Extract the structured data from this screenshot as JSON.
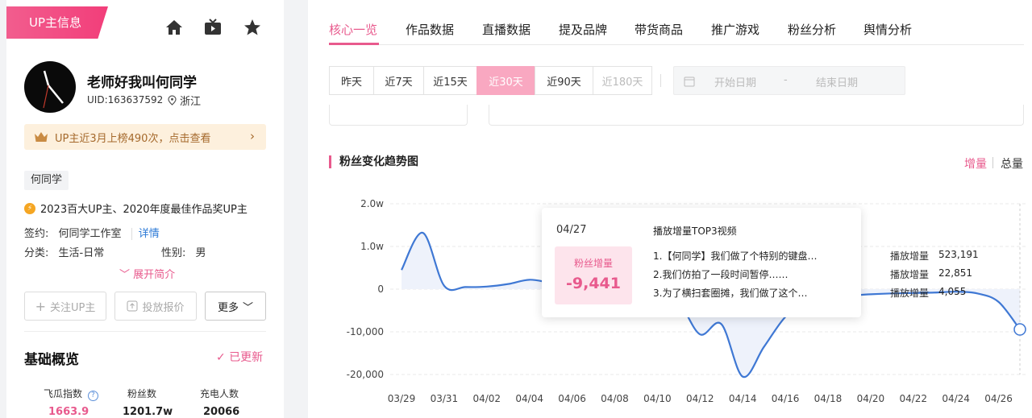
{
  "left": {
    "up_tag": "UP主信息",
    "icons": [
      "home-icon",
      "tv-icon",
      "star-icon"
    ],
    "name": "老师好我叫何同学",
    "uid": "UID:163637592",
    "location": "浙江",
    "rank_banner": "UP主近3月上榜490次，点击查看",
    "tag": "何同学",
    "award": "2023百大UP主、2020年度最佳作品奖UP主",
    "sign_label": "签约:",
    "sign_value": "何同学工作室",
    "detail_link": "详情",
    "category_label": "分类:",
    "category_value": "生活-日常",
    "gender_label": "性别:",
    "gender_value": "男",
    "expand": "展开简介",
    "buttons": {
      "follow": "关注UP主",
      "quote": "投放报价",
      "more": "更多"
    },
    "basic_title": "基础概览",
    "updated": "已更新",
    "metrics": [
      {
        "label": "飞瓜指数",
        "value": "1663.9",
        "color": "#e85a8d"
      },
      {
        "label": "粉丝数",
        "value": "1201.7w",
        "color": "#222222"
      },
      {
        "label": "充电人数",
        "value": "20066",
        "color": "#222222"
      }
    ]
  },
  "tabs": [
    "核心一览",
    "作品数据",
    "直播数据",
    "提及品牌",
    "带货商品",
    "推广游戏",
    "粉丝分析",
    "舆情分析"
  ],
  "active_tab": 0,
  "ranges": [
    "昨天",
    "近7天",
    "近15天",
    "近30天",
    "近90天",
    "近180天"
  ],
  "active_range": 3,
  "date_start": "开始日期",
  "date_end": "结束日期",
  "date_sep": "-",
  "section_title": "粉丝变化趋势图",
  "toggle": {
    "increment": "增量",
    "total": "总量"
  },
  "accent": "#e85a8d",
  "chart_data": {
    "type": "area",
    "y_ticks": [
      "2.0w",
      "1.0w",
      "0",
      "-10,000",
      "-20,000"
    ],
    "ylim": [
      -20000,
      20000
    ],
    "x_ticks": [
      "03/29",
      "03/31",
      "04/02",
      "04/04",
      "04/06",
      "04/08",
      "04/10",
      "04/12",
      "04/14",
      "04/16",
      "04/18",
      "04/20",
      "04/22",
      "04/24",
      "04/26"
    ],
    "x": [
      "03/29",
      "03/30",
      "03/31",
      "04/01",
      "04/02",
      "04/03",
      "04/04",
      "04/05",
      "04/06",
      "04/07",
      "04/08",
      "04/09",
      "04/10",
      "04/11",
      "04/12",
      "04/13",
      "04/14",
      "04/15",
      "04/16",
      "04/17",
      "04/18",
      "04/19",
      "04/20",
      "04/21",
      "04/22",
      "04/23",
      "04/24",
      "04/25",
      "04/26",
      "04/27"
    ],
    "values": [
      4500,
      13200,
      800,
      500,
      600,
      1200,
      2200,
      1500,
      1000,
      -200,
      -500,
      -500,
      -900,
      -3000,
      -10600,
      -8200,
      -20500,
      -13500,
      -6500,
      -3000,
      -1800,
      -1500,
      -1200,
      -1000,
      -900,
      -800,
      -600,
      -1000,
      -3000,
      -9441
    ],
    "line_color": "#3f78d4",
    "fill_color": "#eef2fb",
    "tooltip": {
      "date": "04/27",
      "label": "粉丝增量",
      "value": "-9,441",
      "heading": "播放增量TOP3视频",
      "metric": "播放增量",
      "rows": [
        {
          "title": "1.【何同学】我们做了个特别的键盘…",
          "value": "523,191"
        },
        {
          "title": "2.我们仿拍了一段时间暂停……",
          "value": "22,851"
        },
        {
          "title": "3.为了横扫套圈摊，我们做了这个…",
          "value": "4,055"
        }
      ]
    }
  }
}
